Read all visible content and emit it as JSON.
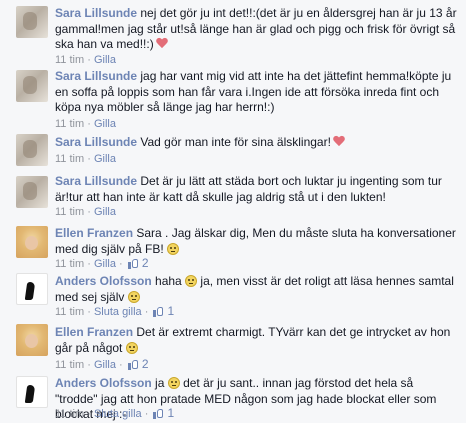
{
  "comments": [
    {
      "author": "Sara Lillsunde",
      "text": "nej det gör ju int det!!:(det är ju en åldersgrej han är ju 13 år gammal!men jag står ut!så länge han är glad och pigg och frisk för övrigt så ska han va med!!:)",
      "time": "11 tim",
      "action": "Gilla"
    },
    {
      "author": "Sara Lillsunde",
      "text": "jag har vant mig vid att inte ha det jättefint hemma!köpte ju en soffa på loppis som han får vara i.Ingen ide att försöka inreda fint och köpa nya möbler så länge jag har herrn!:)",
      "time": "11 tim",
      "action": "Gilla"
    },
    {
      "author": "Sara Lillsunde",
      "text": "Vad gör man inte för sina älsklingar!",
      "time": "11 tim",
      "action": "Gilla"
    },
    {
      "author": "Sara Lillsunde",
      "text": "Det är ju lätt att städa bort och luktar ju ingenting som tur är!tur att han inte är katt då skulle jag aldrig stå ut i den lukten!",
      "time": "11 tim",
      "action": "Gilla"
    },
    {
      "author": "Ellen Franzen",
      "text": "Sara . Jag älskar dig, Men du måste sluta ha konversationer med dig själv på FB!",
      "time": "11 tim",
      "action": "Gilla",
      "likes": "2"
    },
    {
      "author": "Anders Olofsson",
      "text_before": "haha",
      "text_after": "ja, men visst är det roligt att läsa hennes samtal med sej själv",
      "time": "11 tim",
      "action": "Sluta gilla",
      "likes": "1"
    },
    {
      "author": "Ellen Franzen",
      "text": "Det är extremt charmigt. TYvärr kan det ge intrycket av hon går på något",
      "time": "11 tim",
      "action": "Gilla",
      "likes": "2"
    },
    {
      "author": "Anders Olofsson",
      "text_before": "ja",
      "text_after": "det är ju sant.. innan jag förstod det hela så \"trodde\" jag att hon pratade MED någon som jag hade blockat eller som blockat mej :-",
      "time": "11 tim",
      "action": "Sluta gilla",
      "likes": "1"
    }
  ],
  "separator": "·",
  "colors": {
    "link": "#6d84b4",
    "meta": "#90949c",
    "background": "#f6f7f9",
    "heart": "#e36d78"
  }
}
